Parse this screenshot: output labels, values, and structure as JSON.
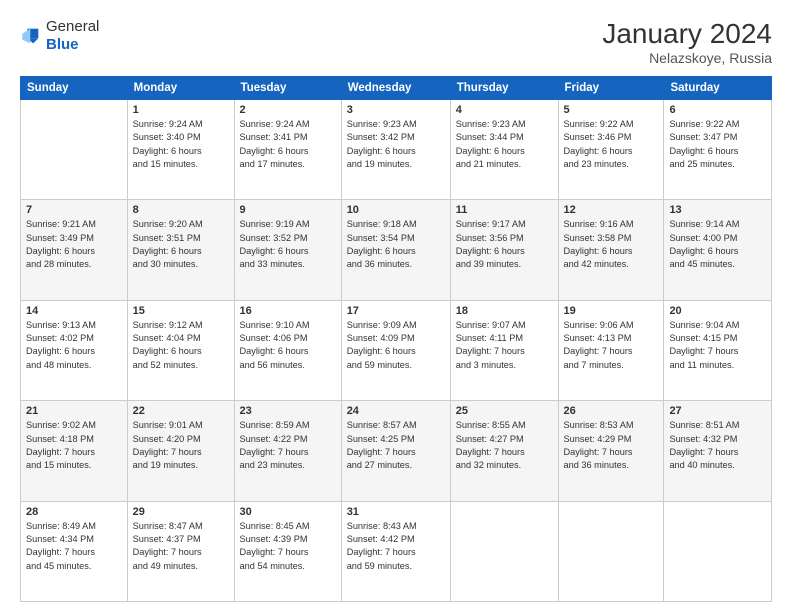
{
  "header": {
    "logo": {
      "general": "General",
      "blue": "Blue"
    },
    "title": "January 2024",
    "subtitle": "Nelazskoye, Russia"
  },
  "calendar": {
    "weekdays": [
      "Sunday",
      "Monday",
      "Tuesday",
      "Wednesday",
      "Thursday",
      "Friday",
      "Saturday"
    ],
    "weeks": [
      [
        {
          "day": null,
          "info": null
        },
        {
          "day": "1",
          "info": "Sunrise: 9:24 AM\nSunset: 3:40 PM\nDaylight: 6 hours\nand 15 minutes."
        },
        {
          "day": "2",
          "info": "Sunrise: 9:24 AM\nSunset: 3:41 PM\nDaylight: 6 hours\nand 17 minutes."
        },
        {
          "day": "3",
          "info": "Sunrise: 9:23 AM\nSunset: 3:42 PM\nDaylight: 6 hours\nand 19 minutes."
        },
        {
          "day": "4",
          "info": "Sunrise: 9:23 AM\nSunset: 3:44 PM\nDaylight: 6 hours\nand 21 minutes."
        },
        {
          "day": "5",
          "info": "Sunrise: 9:22 AM\nSunset: 3:46 PM\nDaylight: 6 hours\nand 23 minutes."
        },
        {
          "day": "6",
          "info": "Sunrise: 9:22 AM\nSunset: 3:47 PM\nDaylight: 6 hours\nand 25 minutes."
        }
      ],
      [
        {
          "day": "7",
          "info": "Sunrise: 9:21 AM\nSunset: 3:49 PM\nDaylight: 6 hours\nand 28 minutes."
        },
        {
          "day": "8",
          "info": "Sunrise: 9:20 AM\nSunset: 3:51 PM\nDaylight: 6 hours\nand 30 minutes."
        },
        {
          "day": "9",
          "info": "Sunrise: 9:19 AM\nSunset: 3:52 PM\nDaylight: 6 hours\nand 33 minutes."
        },
        {
          "day": "10",
          "info": "Sunrise: 9:18 AM\nSunset: 3:54 PM\nDaylight: 6 hours\nand 36 minutes."
        },
        {
          "day": "11",
          "info": "Sunrise: 9:17 AM\nSunset: 3:56 PM\nDaylight: 6 hours\nand 39 minutes."
        },
        {
          "day": "12",
          "info": "Sunrise: 9:16 AM\nSunset: 3:58 PM\nDaylight: 6 hours\nand 42 minutes."
        },
        {
          "day": "13",
          "info": "Sunrise: 9:14 AM\nSunset: 4:00 PM\nDaylight: 6 hours\nand 45 minutes."
        }
      ],
      [
        {
          "day": "14",
          "info": "Sunrise: 9:13 AM\nSunset: 4:02 PM\nDaylight: 6 hours\nand 48 minutes."
        },
        {
          "day": "15",
          "info": "Sunrise: 9:12 AM\nSunset: 4:04 PM\nDaylight: 6 hours\nand 52 minutes."
        },
        {
          "day": "16",
          "info": "Sunrise: 9:10 AM\nSunset: 4:06 PM\nDaylight: 6 hours\nand 56 minutes."
        },
        {
          "day": "17",
          "info": "Sunrise: 9:09 AM\nSunset: 4:09 PM\nDaylight: 6 hours\nand 59 minutes."
        },
        {
          "day": "18",
          "info": "Sunrise: 9:07 AM\nSunset: 4:11 PM\nDaylight: 7 hours\nand 3 minutes."
        },
        {
          "day": "19",
          "info": "Sunrise: 9:06 AM\nSunset: 4:13 PM\nDaylight: 7 hours\nand 7 minutes."
        },
        {
          "day": "20",
          "info": "Sunrise: 9:04 AM\nSunset: 4:15 PM\nDaylight: 7 hours\nand 11 minutes."
        }
      ],
      [
        {
          "day": "21",
          "info": "Sunrise: 9:02 AM\nSunset: 4:18 PM\nDaylight: 7 hours\nand 15 minutes."
        },
        {
          "day": "22",
          "info": "Sunrise: 9:01 AM\nSunset: 4:20 PM\nDaylight: 7 hours\nand 19 minutes."
        },
        {
          "day": "23",
          "info": "Sunrise: 8:59 AM\nSunset: 4:22 PM\nDaylight: 7 hours\nand 23 minutes."
        },
        {
          "day": "24",
          "info": "Sunrise: 8:57 AM\nSunset: 4:25 PM\nDaylight: 7 hours\nand 27 minutes."
        },
        {
          "day": "25",
          "info": "Sunrise: 8:55 AM\nSunset: 4:27 PM\nDaylight: 7 hours\nand 32 minutes."
        },
        {
          "day": "26",
          "info": "Sunrise: 8:53 AM\nSunset: 4:29 PM\nDaylight: 7 hours\nand 36 minutes."
        },
        {
          "day": "27",
          "info": "Sunrise: 8:51 AM\nSunset: 4:32 PM\nDaylight: 7 hours\nand 40 minutes."
        }
      ],
      [
        {
          "day": "28",
          "info": "Sunrise: 8:49 AM\nSunset: 4:34 PM\nDaylight: 7 hours\nand 45 minutes."
        },
        {
          "day": "29",
          "info": "Sunrise: 8:47 AM\nSunset: 4:37 PM\nDaylight: 7 hours\nand 49 minutes."
        },
        {
          "day": "30",
          "info": "Sunrise: 8:45 AM\nSunset: 4:39 PM\nDaylight: 7 hours\nand 54 minutes."
        },
        {
          "day": "31",
          "info": "Sunrise: 8:43 AM\nSunset: 4:42 PM\nDaylight: 7 hours\nand 59 minutes."
        },
        {
          "day": null,
          "info": null
        },
        {
          "day": null,
          "info": null
        },
        {
          "day": null,
          "info": null
        }
      ]
    ]
  }
}
